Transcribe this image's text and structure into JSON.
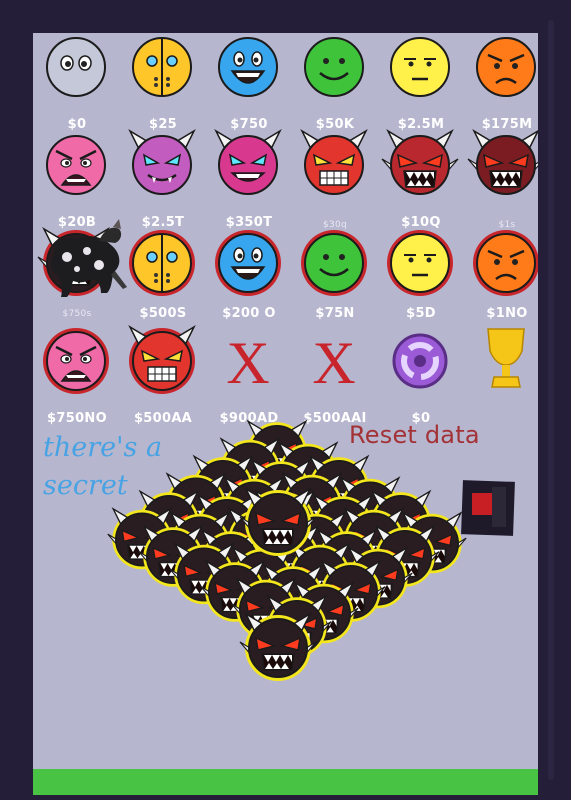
{
  "panel": {
    "background": "#b7b6cf",
    "frame": "#241e38",
    "grass": "#49c344"
  },
  "difficulties": [
    {
      "price": "$0",
      "face": "unrated",
      "color": "#c4c8d8",
      "ring": false
    },
    {
      "price": "$25",
      "face": "auto",
      "color": "#ffc62a",
      "ring": false
    },
    {
      "price": "$750",
      "face": "easy",
      "color": "#38a6ef",
      "ring": false
    },
    {
      "price": "$50K",
      "face": "normal",
      "color": "#3fc33b",
      "ring": false
    },
    {
      "price": "$2.5M",
      "face": "hard",
      "color": "#fff14a",
      "ring": false
    },
    {
      "price": "$175M",
      "face": "harder",
      "color": "#ff7a18",
      "ring": false
    },
    {
      "price": "$20B",
      "face": "insane",
      "color": "#f06aa8",
      "ring": false
    },
    {
      "price": "$2.5T",
      "face": "easy-demon",
      "color": "#c35cbf",
      "ring": false
    },
    {
      "price": "$350T",
      "face": "medium-demon",
      "color": "#d8398f",
      "ring": false
    },
    {
      "price": "$30q",
      "face": "hard-demon",
      "color": "#e2352e",
      "ring": false
    },
    {
      "price": "$10Q",
      "face": "insane-demon",
      "color": "#b8282e",
      "ring": false
    },
    {
      "price": "$1s",
      "face": "extreme-demon",
      "color": "#7a1c22",
      "ring": false
    },
    {
      "price": "$750s",
      "face": "extreme-demon",
      "color": "#2a1d22",
      "ring": true
    },
    {
      "price": "$500S",
      "face": "auto",
      "color": "#ffc62a",
      "ring": true
    },
    {
      "price": "$200 O",
      "face": "easy",
      "color": "#38a6ef",
      "ring": true
    },
    {
      "price": "$75N",
      "face": "normal",
      "color": "#3fc33b",
      "ring": true
    },
    {
      "price": "$5D",
      "face": "hard",
      "color": "#fff14a",
      "ring": true
    },
    {
      "price": "$1NO",
      "face": "harder",
      "color": "#ff7a18",
      "ring": true
    },
    {
      "price": "$750NO",
      "face": "insane",
      "color": "#f06aa8",
      "ring": true
    },
    {
      "price": "$500AA",
      "face": "hard-demon",
      "color": "#e2352e",
      "ring": true
    },
    {
      "price": "$900AD",
      "face": "locked-x",
      "color": "#c8242c",
      "ring": false
    },
    {
      "price": "$500AAI",
      "face": "locked-x",
      "color": "#c8242c",
      "ring": false
    },
    {
      "price": "$0",
      "face": "portal",
      "color": "#9b5bd6",
      "ring": false
    },
    {
      "price": "",
      "face": "trophy",
      "color": "#f5c518",
      "ring": false
    }
  ],
  "secret_text": "there's a secret",
  "reset_label": "Reset data",
  "toggle": {
    "color": "#c81f25",
    "frame": "#1e1a2a"
  },
  "pile": {
    "face": "extreme-demon",
    "glow": "#f4e61c",
    "rows": [
      1,
      2,
      3,
      4,
      5,
      6,
      5,
      4,
      3,
      2,
      1
    ]
  }
}
